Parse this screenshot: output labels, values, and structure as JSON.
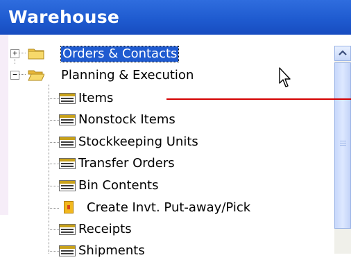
{
  "header": {
    "title": "Warehouse"
  },
  "tree": {
    "items": [
      {
        "label": "Orders & Contacts",
        "expander": "+",
        "icon": "folder-icon",
        "selected": true
      },
      {
        "label": "Planning & Execution",
        "expander": "−",
        "icon": "folder-open-icon"
      },
      {
        "label": "Items",
        "icon": "list-icon"
      },
      {
        "label": "Nonstock Items",
        "icon": "list-icon"
      },
      {
        "label": "Stockkeeping Units",
        "icon": "list-icon"
      },
      {
        "label": "Transfer Orders",
        "icon": "list-icon"
      },
      {
        "label": "Bin Contents",
        "icon": "list-icon"
      },
      {
        "label": "Create Invt. Put-away/Pick",
        "icon": "task-icon"
      },
      {
        "label": "Receipts",
        "icon": "list-icon"
      },
      {
        "label": "Shipments",
        "icon": "list-icon"
      }
    ]
  },
  "colors": {
    "header_bg": "#1f5bd0",
    "selection_bg": "#1f5bd0",
    "pointer_line": "#d40000",
    "left_strip": "#f6edf8"
  }
}
